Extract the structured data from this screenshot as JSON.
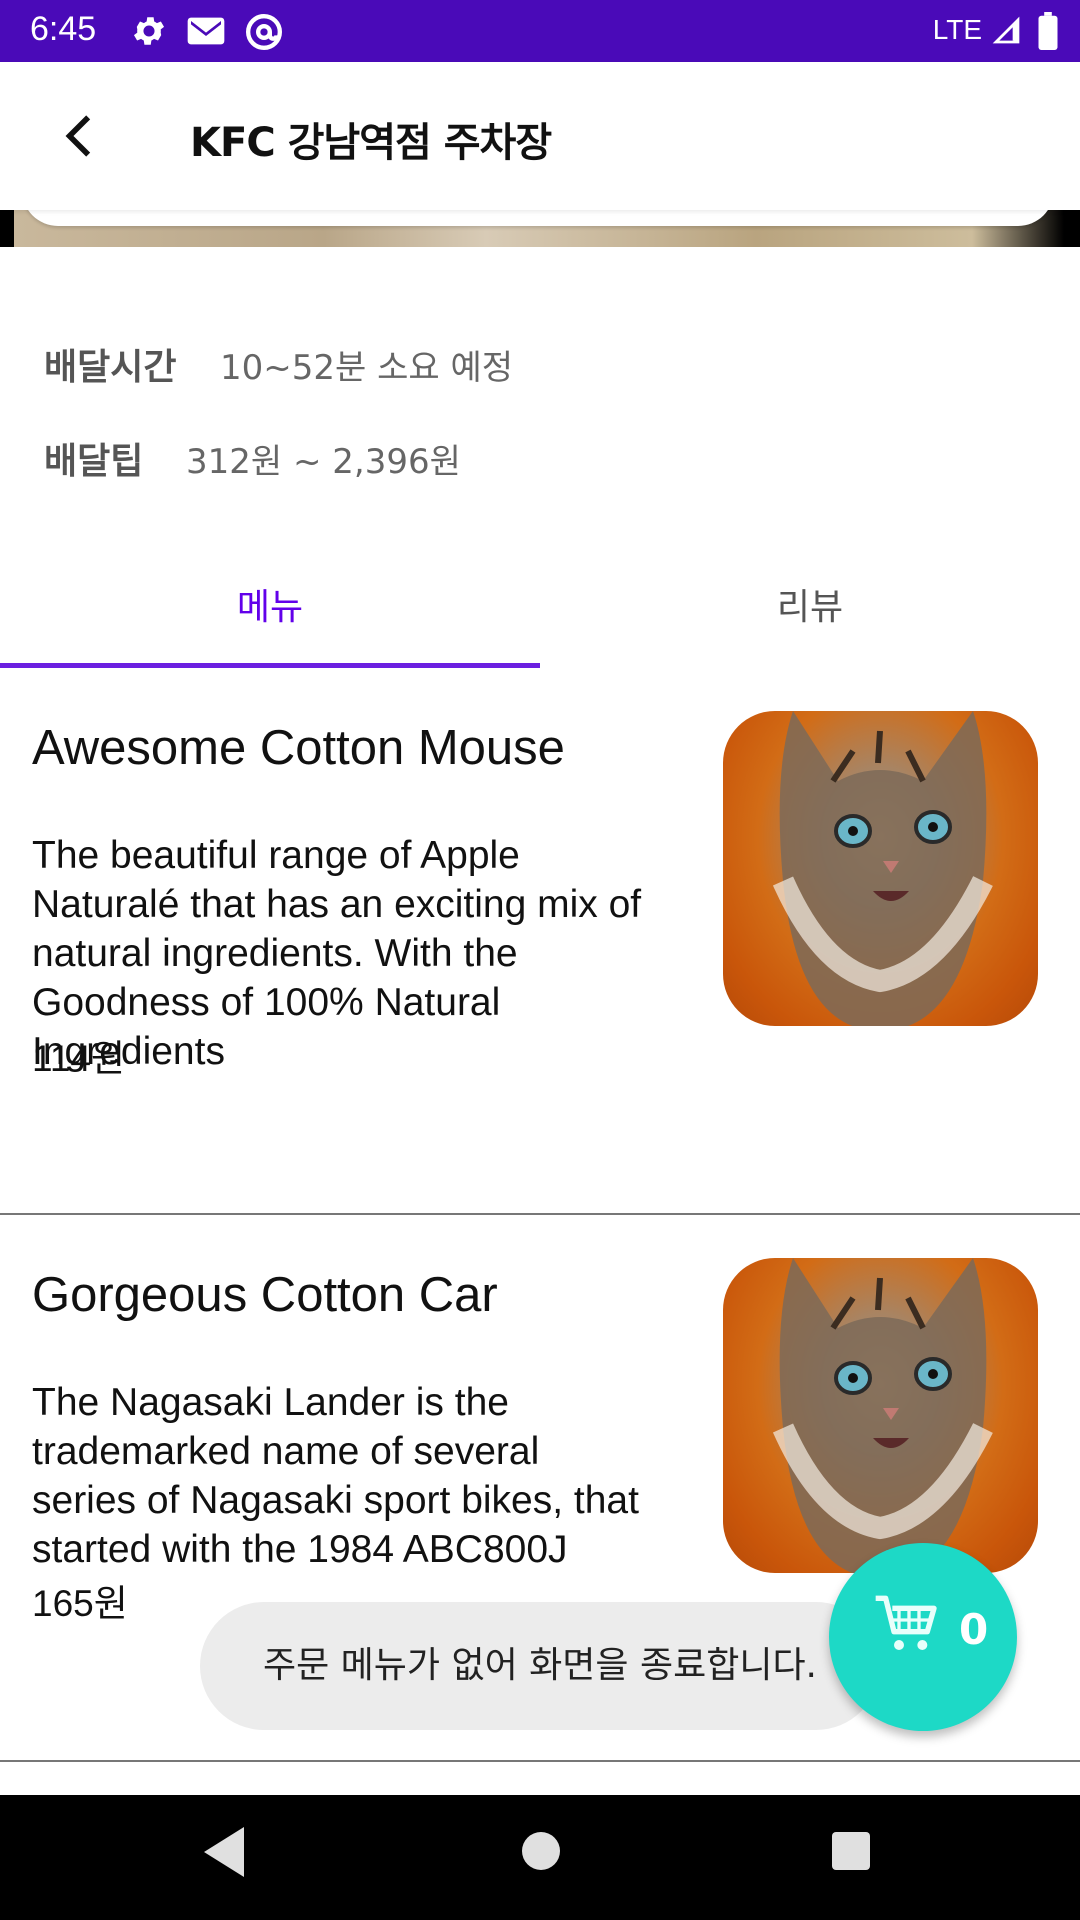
{
  "status_bar": {
    "time": "6:45",
    "network": "LTE",
    "icons": [
      "settings-icon",
      "gmail-icon",
      "at-sign-icon",
      "signal-icon",
      "battery-icon"
    ],
    "background_color": "#4a0ab8"
  },
  "app_bar": {
    "title": "KFC 강남역점 주차장",
    "back_icon": "chevron-left-icon"
  },
  "info": {
    "delivery_time_label": "배달시간",
    "delivery_time_value": "10~52분 소요 예정",
    "delivery_tip_label": "배달팁",
    "delivery_tip_value": "312원 ~ 2,396원"
  },
  "tabs": [
    {
      "label": "메뉴",
      "selected": true
    },
    {
      "label": "리뷰",
      "selected": false
    }
  ],
  "accent_color": "#6200ea",
  "menu_items": [
    {
      "name": "Awesome Cotton Mouse",
      "description": "The beautiful range of Apple Naturalé that has an exciting mix of natural ingredients. With the Goodness of 100% Natural Ingredients",
      "price": "114원",
      "image": "cat-photo"
    },
    {
      "name": "Gorgeous Cotton Car",
      "description": "The Nagasaki Lander is the trademarked name of several series of Nagasaki sport bikes, that started with the 1984 ABC800J",
      "price": "165원",
      "image": "cat-photo"
    }
  ],
  "toast": {
    "message": "주문 메뉴가 없어 화면을 종료합니다."
  },
  "cart_fab": {
    "count": "0",
    "icon": "shopping-cart-icon",
    "color": "#1dd9c6"
  },
  "nav_bar": {
    "buttons": [
      "back-triangle-icon",
      "home-circle-icon",
      "recents-square-icon"
    ]
  }
}
